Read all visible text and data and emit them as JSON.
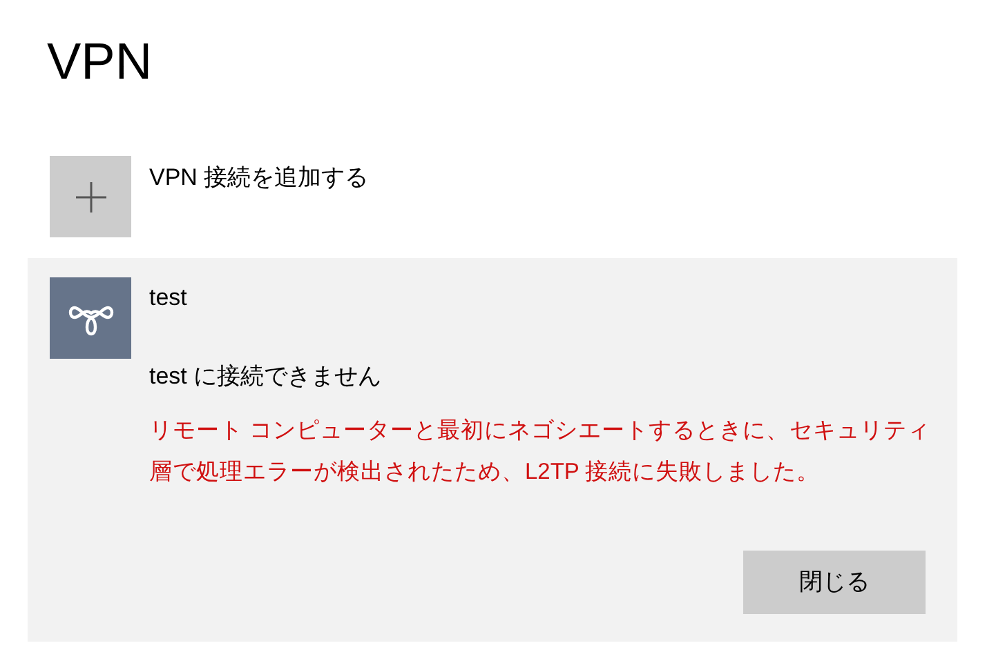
{
  "page_title": "VPN",
  "add_connection": {
    "label": "VPN 接続を追加する"
  },
  "connections": [
    {
      "name": "test",
      "expanded": true,
      "status": "test に接続できません",
      "error": "リモート コンピューターと最初にネゴシエートするときに、セキュリティ層で処理エラーが検出されたため、L2TP 接続に失敗しました。",
      "button": "閉じる"
    }
  ]
}
